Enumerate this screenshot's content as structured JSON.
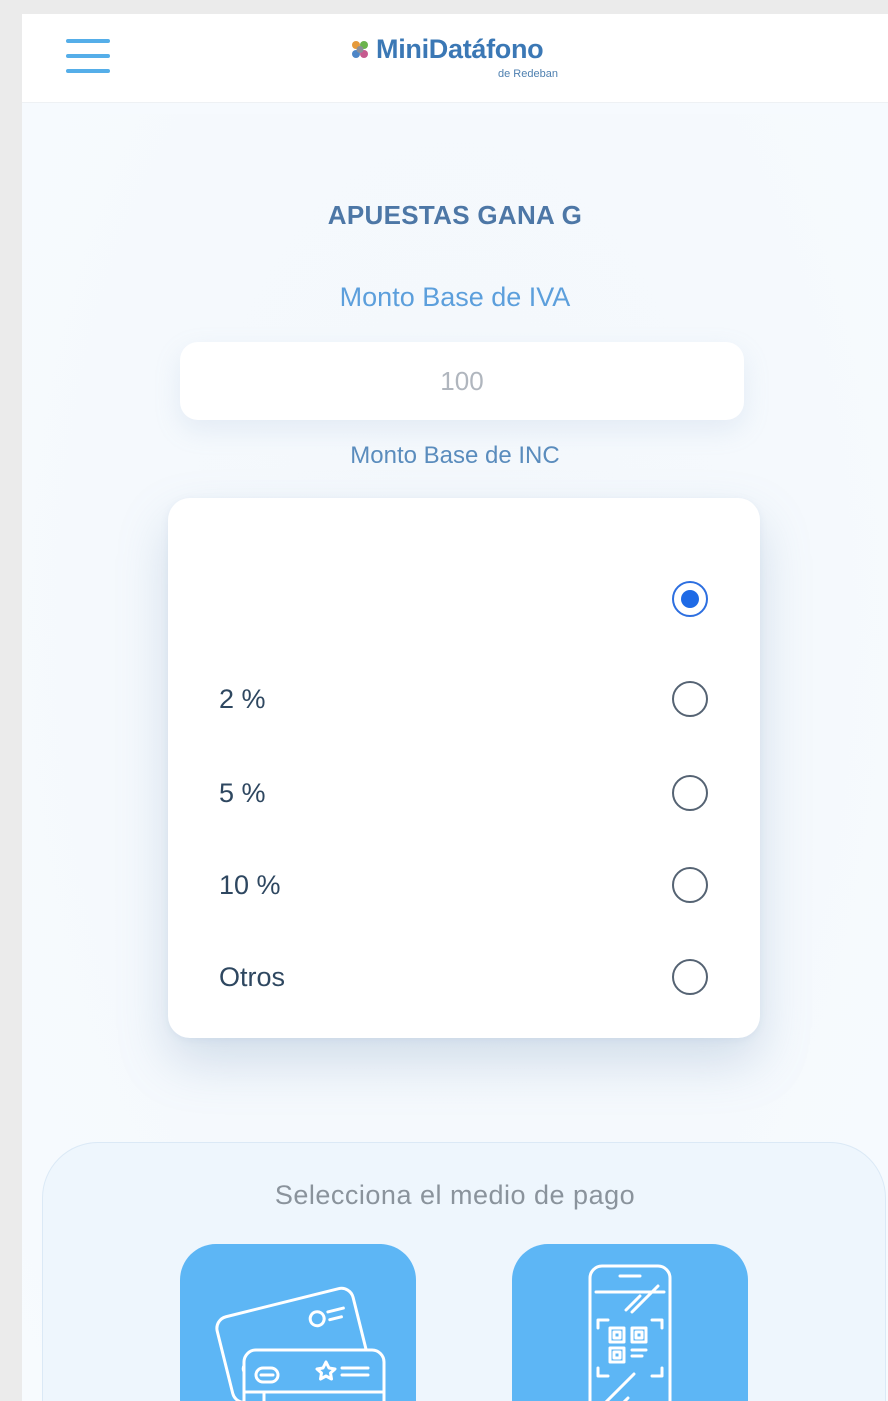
{
  "header": {
    "menu_icon": "hamburger-menu-icon",
    "logo_text": "MiniDatáfono",
    "logo_sub": "de Redeban"
  },
  "merchant": {
    "name": "APUESTAS GANA G"
  },
  "iva": {
    "label": "Monto Base de IVA",
    "value": "100"
  },
  "inc": {
    "label": "Monto Base de INC",
    "options": [
      {
        "label": "",
        "selected": true
      },
      {
        "label": "2 %",
        "selected": false
      },
      {
        "label": "5 %",
        "selected": false
      },
      {
        "label": "10 %",
        "selected": false
      },
      {
        "label": "Otros",
        "selected": false
      }
    ]
  },
  "payment": {
    "label": "Selecciona el medio de pago",
    "methods": [
      {
        "icon": "credit-cards-icon"
      },
      {
        "icon": "qr-phone-icon"
      }
    ]
  },
  "colors": {
    "accent": "#5db6f5",
    "title": "#4d77a6",
    "radio_selected": "#1e6ae6"
  }
}
